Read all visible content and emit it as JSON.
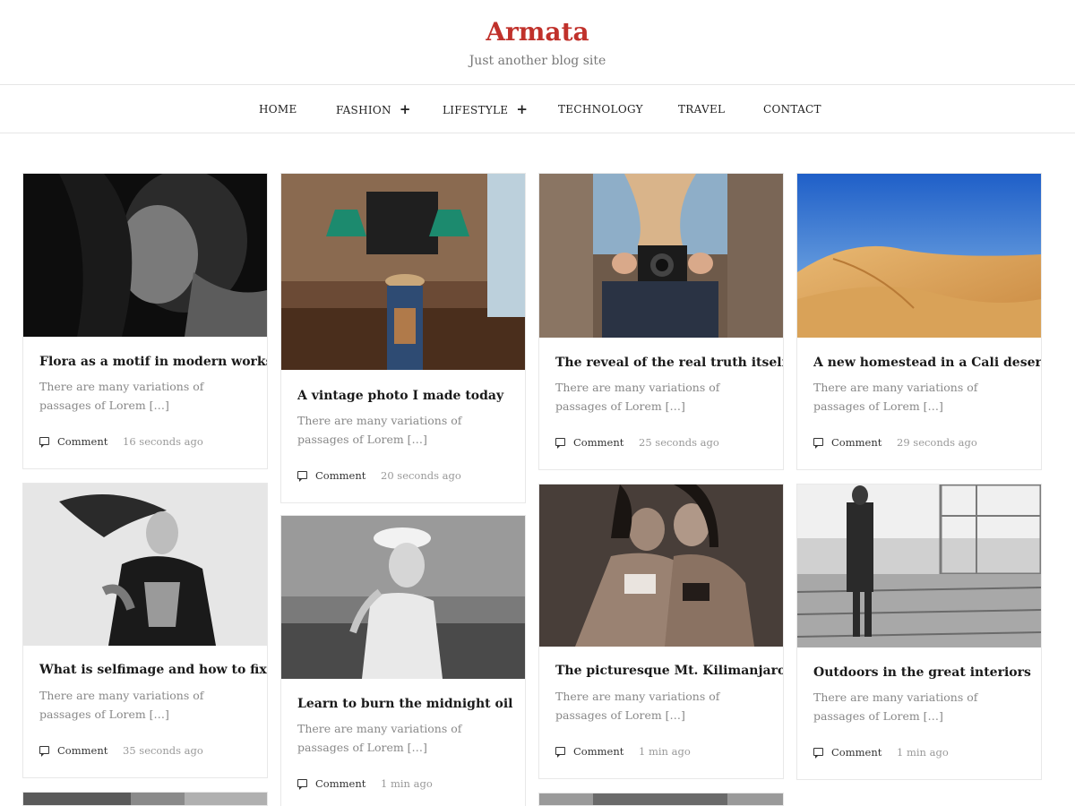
{
  "site": {
    "title": "Armata",
    "tagline": "Just another blog site"
  },
  "nav": [
    {
      "label": "HOME"
    },
    {
      "label": "FASHION",
      "plus": "+"
    },
    {
      "label": "LIFESTYLE",
      "plus": "+"
    },
    {
      "label": "TECHNOLOGY"
    },
    {
      "label": "TRAVEL"
    },
    {
      "label": "CONTACT"
    }
  ],
  "posts": [
    {
      "title": "Flora as a motif in modern works",
      "excerpt": "There are many variations of passages of Lorem […]",
      "comment": "Comment",
      "time": "16 seconds ago"
    },
    {
      "title": "A vintage photo I made today",
      "excerpt": "There are many variations of passages of Lorem […]",
      "comment": "Comment",
      "time": "20 seconds ago"
    },
    {
      "title": "The reveal of the real truth itself",
      "excerpt": "There are many variations of passages of Lorem […]",
      "comment": "Comment",
      "time": "25 seconds ago"
    },
    {
      "title": "A new homestead in a Cali desert",
      "excerpt": "There are many variations of passages of Lorem […]",
      "comment": "Comment",
      "time": "29 seconds ago"
    },
    {
      "title": "What is selfimage and how to fix it",
      "excerpt": "There are many variations of passages of Lorem […]",
      "comment": "Comment",
      "time": "35 seconds ago"
    },
    {
      "title": "Learn to burn the midnight oil",
      "excerpt": "There are many variations of passages of Lorem […]",
      "comment": "Comment",
      "time": "1 min ago"
    },
    {
      "title": "The picturesque Mt. Kilimanjaro",
      "excerpt": "There are many variations of passages of Lorem […]",
      "comment": "Comment",
      "time": "1 min ago"
    },
    {
      "title": "Outdoors in the great interiors",
      "excerpt": "There are many variations of passages of Lorem […]",
      "comment": "Comment",
      "time": "1 min ago"
    }
  ]
}
